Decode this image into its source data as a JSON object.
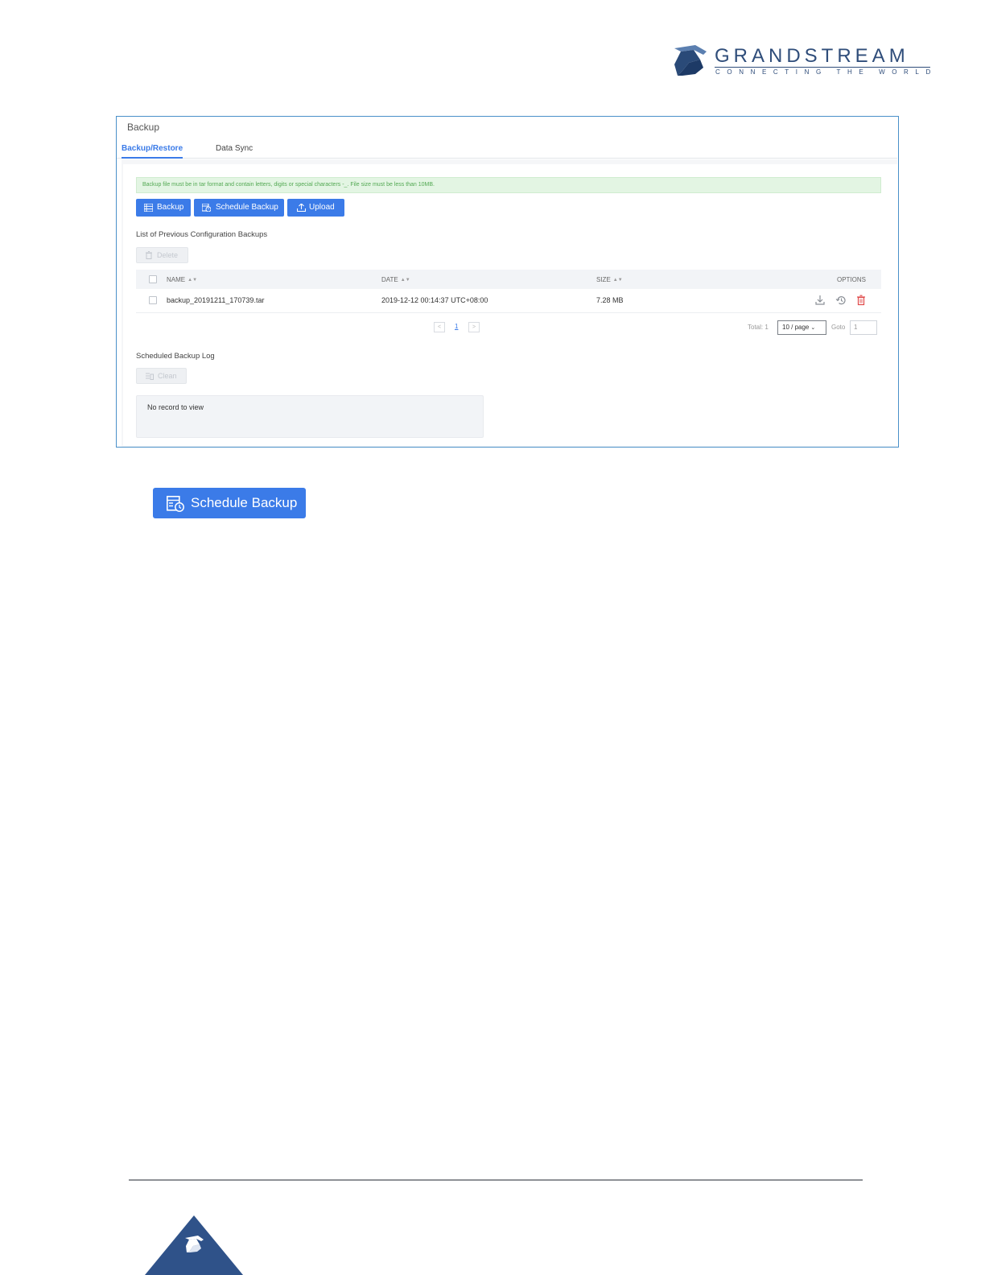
{
  "brand": {
    "name": "GRANDSTREAM",
    "tagline": "CONNECTING THE WORLD",
    "color": "#2f4d7a"
  },
  "panel": {
    "title": "Backup",
    "tabs": [
      {
        "label": "Backup/Restore",
        "active": true
      },
      {
        "label": "Data Sync",
        "active": false
      }
    ],
    "notice": "Backup file must be in tar format and contain letters, digits or special characters -_. File size must be less than 10MB.",
    "buttons": {
      "backup": "Backup",
      "schedule_backup": "Schedule Backup",
      "upload": "Upload"
    },
    "list_title": "List of Previous Configuration Backups",
    "delete_label": "Delete",
    "table": {
      "columns": [
        "NAME",
        "DATE",
        "SIZE",
        "OPTIONS"
      ],
      "rows": [
        {
          "name": "backup_20191211_170739.tar",
          "date": "2019-12-12 00:14:37 UTC+08:00",
          "size": "7.28 MB"
        }
      ],
      "options_icons": [
        "download-icon",
        "restore-icon",
        "delete-icon"
      ]
    },
    "pagination": {
      "prev": "<",
      "current": "1",
      "next": ">",
      "total": "Total: 1",
      "per_page": "10 / page",
      "goto_label": "Goto",
      "goto_value": "1"
    },
    "log_title": "Scheduled Backup Log",
    "clean_label": "Clean",
    "log_empty": "No record to view"
  },
  "figure_button": {
    "label": "Schedule Backup"
  },
  "colors": {
    "accent": "#3b7be8",
    "panel_border": "#4a90c9",
    "notice_bg": "#e3f5e3",
    "notice_text": "#52a852",
    "danger": "#e04a4a"
  }
}
